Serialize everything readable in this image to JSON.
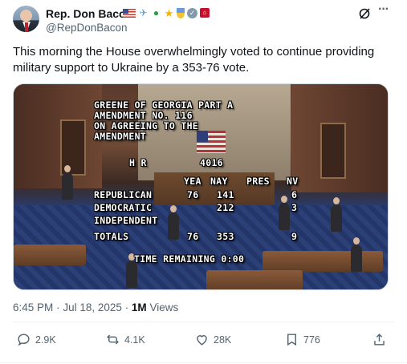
{
  "author": {
    "name": "Rep. Don Bacon",
    "handle": "@RepDonBacon",
    "name_icons": [
      "us-flag-icon",
      "airplane-icon",
      "tractor-icon",
      "star-icon",
      "medal-icon",
      "verified-badge-icon",
      "affiliate-badge-icon"
    ]
  },
  "tweet": {
    "text": "This morning the House overwhelmingly voted to continue providing military support to Ukraine by a 353-76 vote."
  },
  "media": {
    "overlay": {
      "title_line1": "GREENE OF GEORGIA PART A",
      "title_line2": "AMENDMENT NO. 116",
      "title_line3": "ON AGREEING TO THE",
      "title_line4": "AMENDMENT",
      "hr_label": "H R",
      "hr_number": "4016",
      "col_yea": "YEA",
      "col_nay": "NAY",
      "col_pres": "PRES",
      "col_nv": "NV",
      "rows": [
        {
          "party": "REPUBLICAN",
          "yea": "76",
          "nay": "141",
          "pres": "",
          "nv": "6"
        },
        {
          "party": "DEMOCRATIC",
          "yea": "",
          "nay": "212",
          "pres": "",
          "nv": "3"
        },
        {
          "party": "INDEPENDENT",
          "yea": "",
          "nay": "",
          "pres": "",
          "nv": ""
        },
        {
          "party": "TOTALS",
          "yea": "76",
          "nay": "353",
          "pres": "",
          "nv": "9"
        }
      ],
      "time_remaining": "TIME REMAINING 0:00"
    }
  },
  "meta": {
    "time": "6:45 PM",
    "separator": "·",
    "date": "Jul 18, 2025",
    "views_count": "1M",
    "views_label": "Views"
  },
  "actions": {
    "replies": "2.9K",
    "reposts": "4.1K",
    "likes": "28K",
    "bookmarks": "776"
  },
  "colors": {
    "text": "#0f1419",
    "secondary": "#536471",
    "divider": "#eff3f4",
    "verified_badge": "#829aab"
  }
}
